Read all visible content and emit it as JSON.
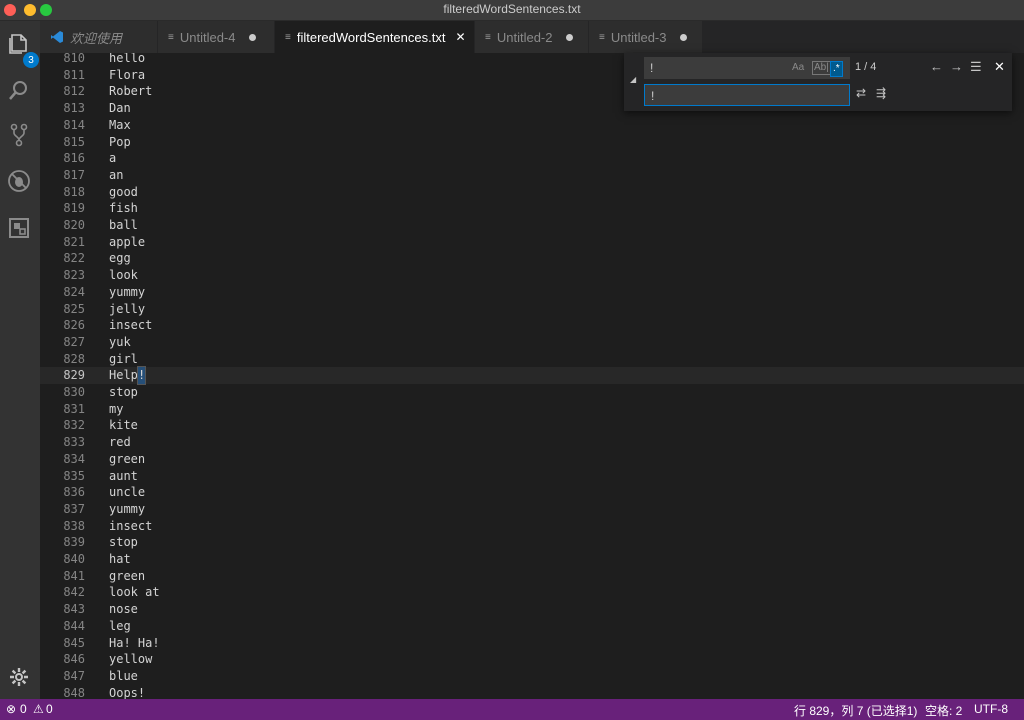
{
  "window": {
    "title": "filteredWordSentences.txt"
  },
  "activity": {
    "explorer_badge": "3"
  },
  "tabs": [
    {
      "label": "欢迎使用",
      "icon": "vscode-logo-icon"
    },
    {
      "label": "Untitled-4",
      "dirty": true
    },
    {
      "label": "filteredWordSentences.txt",
      "active": true,
      "close": "✕"
    },
    {
      "label": "Untitled-2",
      "dirty": true
    },
    {
      "label": "Untitled-3",
      "dirty": true
    }
  ],
  "editor": {
    "lines": [
      {
        "n": "810",
        "t": "hello"
      },
      {
        "n": "811",
        "t": "Flora"
      },
      {
        "n": "812",
        "t": "Robert"
      },
      {
        "n": "813",
        "t": "Dan"
      },
      {
        "n": "814",
        "t": "Max"
      },
      {
        "n": "815",
        "t": "Pop"
      },
      {
        "n": "816",
        "t": "a"
      },
      {
        "n": "817",
        "t": "an"
      },
      {
        "n": "818",
        "t": "good"
      },
      {
        "n": "819",
        "t": "fish"
      },
      {
        "n": "820",
        "t": "ball"
      },
      {
        "n": "821",
        "t": "apple"
      },
      {
        "n": "822",
        "t": "egg"
      },
      {
        "n": "823",
        "t": "look"
      },
      {
        "n": "824",
        "t": "yummy"
      },
      {
        "n": "825",
        "t": "jelly"
      },
      {
        "n": "826",
        "t": "insect"
      },
      {
        "n": "827",
        "t": "yuk"
      },
      {
        "n": "828",
        "t": "girl"
      },
      {
        "n": "829",
        "t": "Help"
      },
      {
        "n": "830",
        "t": "stop"
      },
      {
        "n": "831",
        "t": "my"
      },
      {
        "n": "832",
        "t": "kite"
      },
      {
        "n": "833",
        "t": "red"
      },
      {
        "n": "834",
        "t": "green"
      },
      {
        "n": "835",
        "t": "aunt"
      },
      {
        "n": "836",
        "t": "uncle"
      },
      {
        "n": "837",
        "t": "yummy"
      },
      {
        "n": "838",
        "t": "insect"
      },
      {
        "n": "839",
        "t": "stop"
      },
      {
        "n": "840",
        "t": "hat"
      },
      {
        "n": "841",
        "t": "green"
      },
      {
        "n": "842",
        "t": "look at"
      },
      {
        "n": "843",
        "t": "nose"
      },
      {
        "n": "844",
        "t": "leg"
      },
      {
        "n": "845",
        "t": "Ha! Ha!"
      },
      {
        "n": "846",
        "t": "yellow"
      },
      {
        "n": "847",
        "t": "blue"
      },
      {
        "n": "848",
        "t": "Oops!"
      }
    ],
    "current_line": "829",
    "selected_text": "!"
  },
  "find": {
    "find_value": "!",
    "replace_value": "!",
    "match_case_label": "Aa",
    "whole_word_label": "Ab|",
    "regex_label": ".*",
    "match_count": "1 / 4"
  },
  "status": {
    "errors": "0",
    "warnings": "0",
    "position": "行 829，列 7 (已选择1)",
    "indent": "空格: 2",
    "encoding": "UTF-8"
  },
  "colors": {
    "statusbar": "#68217a",
    "accent": "#007acc",
    "editor_bg": "#1e1e1e"
  }
}
